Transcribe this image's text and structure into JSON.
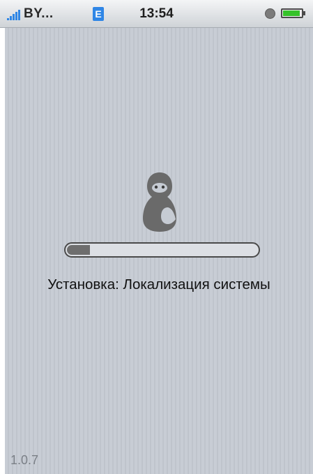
{
  "statusbar": {
    "carrier": "BY...",
    "network_type": "E",
    "time": "13:54",
    "icons": {
      "signal": "signal-strength-icon",
      "network": "edge-network-icon",
      "alarm": "clock-icon",
      "battery": "battery-icon"
    },
    "battery_level": 0.85,
    "colors": {
      "network_badge": "#2f86e6",
      "battery_fill": "#35c229"
    }
  },
  "installer": {
    "logo": "matryoshka-logo-icon",
    "progress": 0.12,
    "status": "Установка: Локализация системы",
    "version": "1.0.7"
  }
}
